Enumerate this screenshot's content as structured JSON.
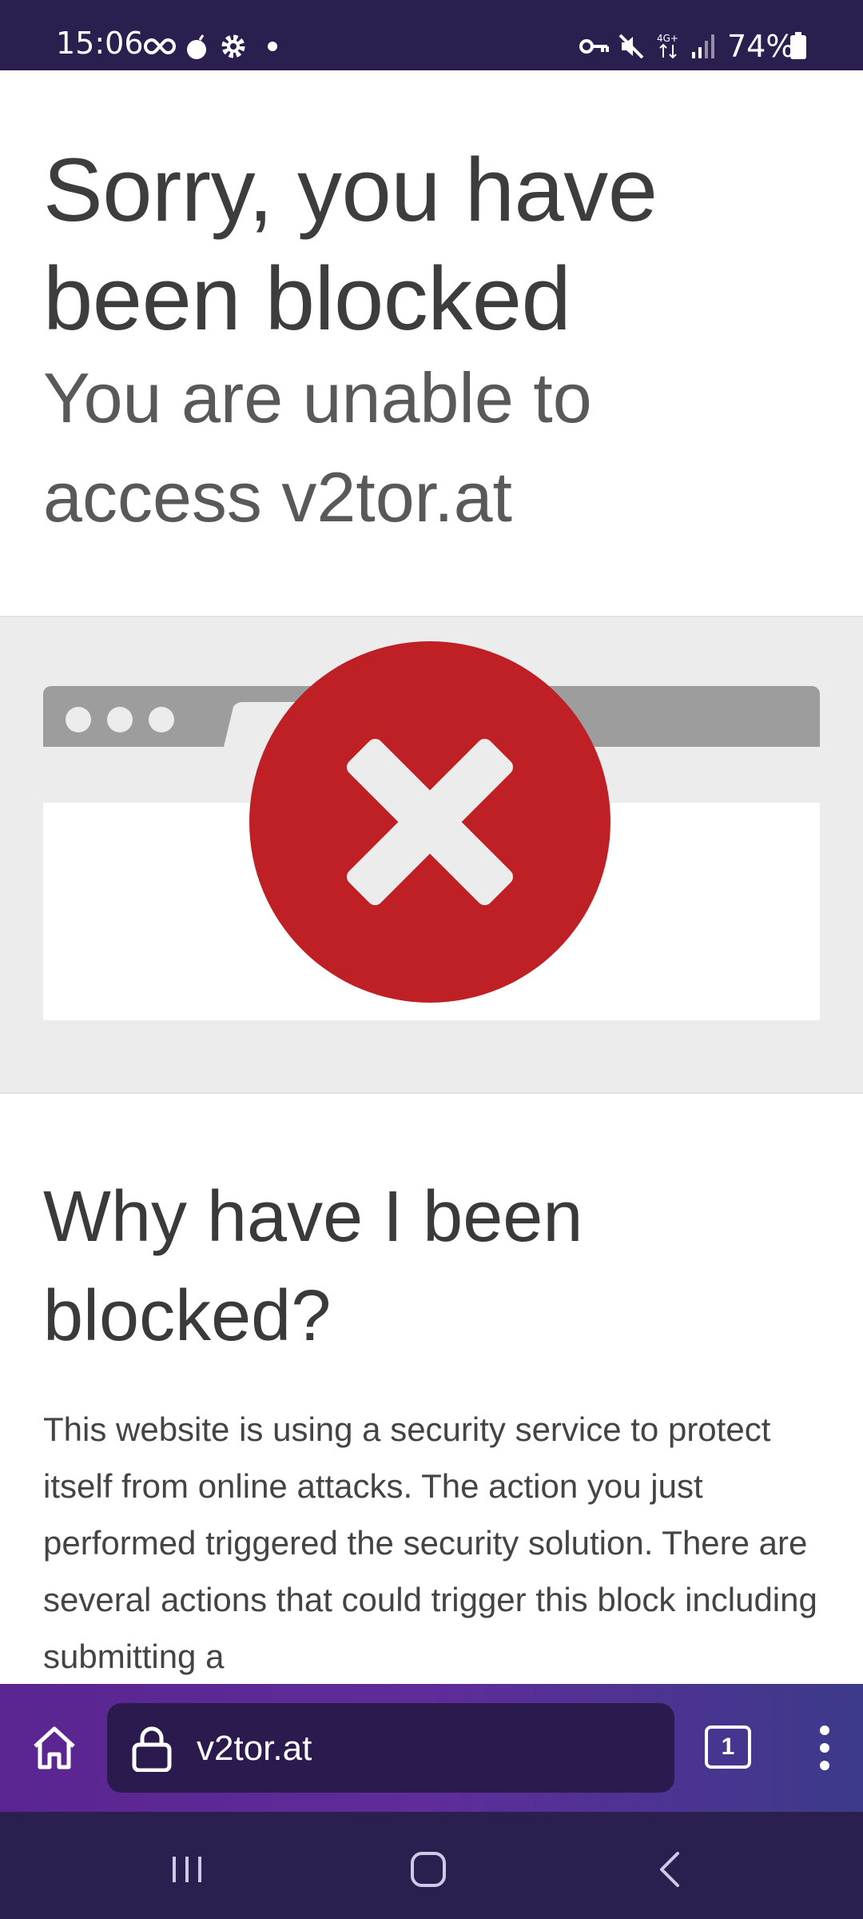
{
  "status_bar": {
    "time": "15:06",
    "battery": "74%",
    "network": "4G+",
    "icons": [
      "infinity-icon",
      "bomb-icon",
      "settings-icon",
      "dot-icon",
      "vpn-key-icon",
      "mute-icon",
      "network-4g-icon",
      "signal-icon",
      "battery-icon"
    ]
  },
  "page": {
    "title": "Sorry, you have been blocked",
    "subtitle": "You are unable to access v2tor.at",
    "why_heading": "Why have I been blocked?",
    "why_body": "This website is using a security service to protect itself from online attacks. The action you just performed triggered the security solution. There are several actions that could trigger this block including submitting a"
  },
  "colors": {
    "status_bg": "#2a1f4f",
    "error_red": "#be2026",
    "toolbar_start": "#5a2590",
    "toolbar_end": "#3c3a8a"
  },
  "browser": {
    "url": "v2tor.at",
    "tab_count": "1"
  },
  "nav": {
    "icons": [
      "recents-icon",
      "home-icon",
      "back-icon"
    ]
  }
}
